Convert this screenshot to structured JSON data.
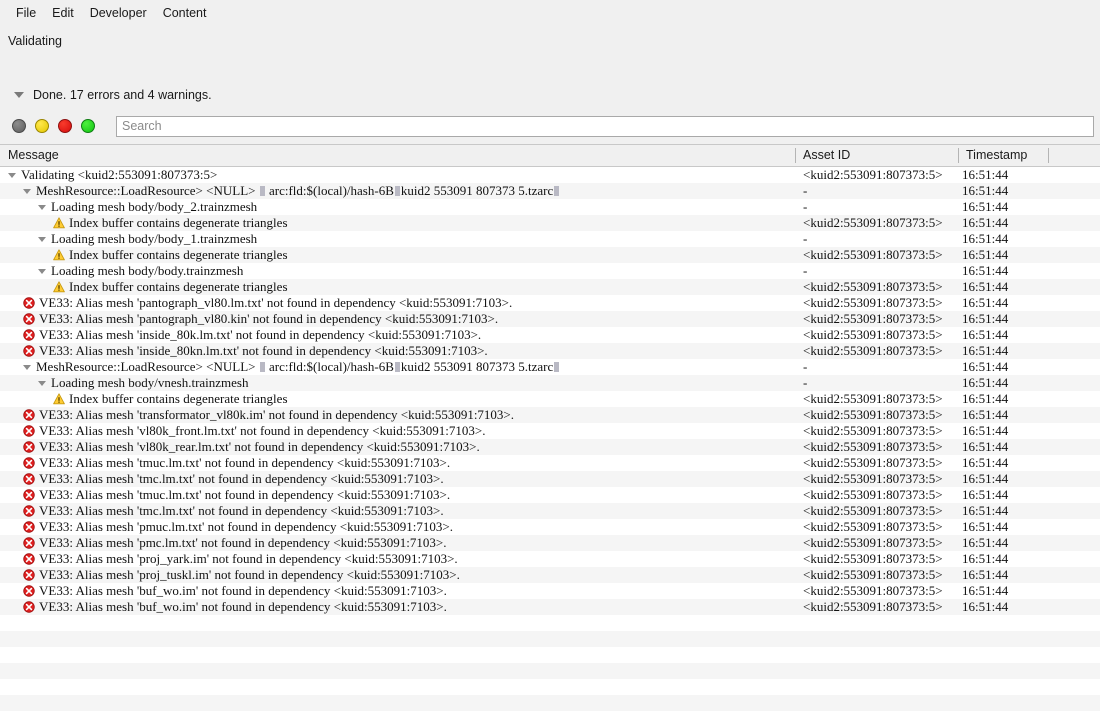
{
  "menu": {
    "items": [
      {
        "label": "File"
      },
      {
        "label": "Edit"
      },
      {
        "label": "Developer"
      },
      {
        "label": "Content"
      }
    ]
  },
  "status": {
    "label": "Validating"
  },
  "summary": {
    "text": "Done. 17 errors and 4 warnings.",
    "expander_icon": "triangle-down-icon"
  },
  "filters": {
    "dots": [
      {
        "name": "filter-dot-gray",
        "color": "#6d6d6d"
      },
      {
        "name": "filter-dot-yellow",
        "color": "#e8d000"
      },
      {
        "name": "filter-dot-red",
        "color": "#dd1111"
      },
      {
        "name": "filter-dot-green",
        "color": "#1fd01f"
      }
    ]
  },
  "search": {
    "placeholder": "Search",
    "value": ""
  },
  "table": {
    "columns": [
      {
        "key": "message",
        "label": "Message"
      },
      {
        "key": "asset_id",
        "label": "Asset ID"
      },
      {
        "key": "timestamp",
        "label": "Timestamp"
      },
      {
        "key": "extra",
        "label": ""
      }
    ],
    "rows": [
      {
        "indent": 0,
        "icon": "triangle-down-icon",
        "message": "Validating <kuid2:553091:807373:5>",
        "asset_id": "<kuid2:553091:807373:5>",
        "timestamp": "16:51:44"
      },
      {
        "indent": 1,
        "icon": "triangle-down-icon",
        "message": "MeshResource::LoadResource> <NULL> | arc:fld:$(local)/hash-6B|kuid2 553091 807373 5.tzarc|",
        "asset_id": "-",
        "timestamp": "16:51:44"
      },
      {
        "indent": 2,
        "icon": "triangle-down-icon",
        "message": "Loading mesh body/body_2.trainzmesh",
        "asset_id": "-",
        "timestamp": "16:51:44"
      },
      {
        "indent": 3,
        "icon": "warning-icon",
        "message": "Index buffer contains degenerate triangles",
        "asset_id": "<kuid2:553091:807373:5>",
        "timestamp": "16:51:44"
      },
      {
        "indent": 2,
        "icon": "triangle-down-icon",
        "message": "Loading mesh body/body_1.trainzmesh",
        "asset_id": "-",
        "timestamp": "16:51:44"
      },
      {
        "indent": 3,
        "icon": "warning-icon",
        "message": "Index buffer contains degenerate triangles",
        "asset_id": "<kuid2:553091:807373:5>",
        "timestamp": "16:51:44"
      },
      {
        "indent": 2,
        "icon": "triangle-down-icon",
        "message": "Loading mesh body/body.trainzmesh",
        "asset_id": "-",
        "timestamp": "16:51:44"
      },
      {
        "indent": 3,
        "icon": "warning-icon",
        "message": "Index buffer contains degenerate triangles",
        "asset_id": "<kuid2:553091:807373:5>",
        "timestamp": "16:51:44"
      },
      {
        "indent": 1,
        "icon": "error-icon",
        "message": "VE33: Alias mesh 'pantograph_vl80.lm.txt' not found in dependency <kuid:553091:7103>.",
        "asset_id": "<kuid2:553091:807373:5>",
        "timestamp": "16:51:44"
      },
      {
        "indent": 1,
        "icon": "error-icon",
        "message": "VE33: Alias mesh 'pantograph_vl80.kin' not found in dependency <kuid:553091:7103>.",
        "asset_id": "<kuid2:553091:807373:5>",
        "timestamp": "16:51:44"
      },
      {
        "indent": 1,
        "icon": "error-icon",
        "message": "VE33: Alias mesh 'inside_80k.lm.txt' not found in dependency <kuid:553091:7103>.",
        "asset_id": "<kuid2:553091:807373:5>",
        "timestamp": "16:51:44"
      },
      {
        "indent": 1,
        "icon": "error-icon",
        "message": "VE33: Alias mesh 'inside_80kn.lm.txt' not found in dependency <kuid:553091:7103>.",
        "asset_id": "<kuid2:553091:807373:5>",
        "timestamp": "16:51:44"
      },
      {
        "indent": 1,
        "icon": "triangle-down-icon",
        "message": "MeshResource::LoadResource> <NULL> | arc:fld:$(local)/hash-6B|kuid2 553091 807373 5.tzarc|",
        "asset_id": "-",
        "timestamp": "16:51:44"
      },
      {
        "indent": 2,
        "icon": "triangle-down-icon",
        "message": "Loading mesh body/vnesh.trainzmesh",
        "asset_id": "-",
        "timestamp": "16:51:44"
      },
      {
        "indent": 3,
        "icon": "warning-icon",
        "message": "Index buffer contains degenerate triangles",
        "asset_id": "<kuid2:553091:807373:5>",
        "timestamp": "16:51:44"
      },
      {
        "indent": 1,
        "icon": "error-icon",
        "message": "VE33: Alias mesh 'transformator_vl80k.im' not found in dependency <kuid:553091:7103>.",
        "asset_id": "<kuid2:553091:807373:5>",
        "timestamp": "16:51:44"
      },
      {
        "indent": 1,
        "icon": "error-icon",
        "message": "VE33: Alias mesh 'vl80k_front.lm.txt' not found in dependency <kuid:553091:7103>.",
        "asset_id": "<kuid2:553091:807373:5>",
        "timestamp": "16:51:44"
      },
      {
        "indent": 1,
        "icon": "error-icon",
        "message": "VE33: Alias mesh 'vl80k_rear.lm.txt' not found in dependency <kuid:553091:7103>.",
        "asset_id": "<kuid2:553091:807373:5>",
        "timestamp": "16:51:44"
      },
      {
        "indent": 1,
        "icon": "error-icon",
        "message": "VE33: Alias mesh 'tmuc.lm.txt' not found in dependency <kuid:553091:7103>.",
        "asset_id": "<kuid2:553091:807373:5>",
        "timestamp": "16:51:44"
      },
      {
        "indent": 1,
        "icon": "error-icon",
        "message": "VE33: Alias mesh 'tmc.lm.txt' not found in dependency <kuid:553091:7103>.",
        "asset_id": "<kuid2:553091:807373:5>",
        "timestamp": "16:51:44"
      },
      {
        "indent": 1,
        "icon": "error-icon",
        "message": "VE33: Alias mesh 'tmuc.lm.txt' not found in dependency <kuid:553091:7103>.",
        "asset_id": "<kuid2:553091:807373:5>",
        "timestamp": "16:51:44"
      },
      {
        "indent": 1,
        "icon": "error-icon",
        "message": "VE33: Alias mesh 'tmc.lm.txt' not found in dependency <kuid:553091:7103>.",
        "asset_id": "<kuid2:553091:807373:5>",
        "timestamp": "16:51:44"
      },
      {
        "indent": 1,
        "icon": "error-icon",
        "message": "VE33: Alias mesh 'pmuc.lm.txt' not found in dependency <kuid:553091:7103>.",
        "asset_id": "<kuid2:553091:807373:5>",
        "timestamp": "16:51:44"
      },
      {
        "indent": 1,
        "icon": "error-icon",
        "message": "VE33: Alias mesh 'pmc.lm.txt' not found in dependency <kuid:553091:7103>.",
        "asset_id": "<kuid2:553091:807373:5>",
        "timestamp": "16:51:44"
      },
      {
        "indent": 1,
        "icon": "error-icon",
        "message": "VE33: Alias mesh 'proj_yark.im' not found in dependency <kuid:553091:7103>.",
        "asset_id": "<kuid2:553091:807373:5>",
        "timestamp": "16:51:44"
      },
      {
        "indent": 1,
        "icon": "error-icon",
        "message": "VE33: Alias mesh 'proj_tuskl.im' not found in dependency <kuid:553091:7103>.",
        "asset_id": "<kuid2:553091:807373:5>",
        "timestamp": "16:51:44"
      },
      {
        "indent": 1,
        "icon": "error-icon",
        "message": "VE33: Alias mesh 'buf_wo.im' not found in dependency <kuid:553091:7103>.",
        "asset_id": "<kuid2:553091:807373:5>",
        "timestamp": "16:51:44"
      },
      {
        "indent": 1,
        "icon": "error-icon",
        "message": "VE33: Alias mesh 'buf_wo.im' not found in dependency <kuid:553091:7103>.",
        "asset_id": "<kuid2:553091:807373:5>",
        "timestamp": "16:51:44"
      }
    ],
    "empty_row_count": 6
  }
}
